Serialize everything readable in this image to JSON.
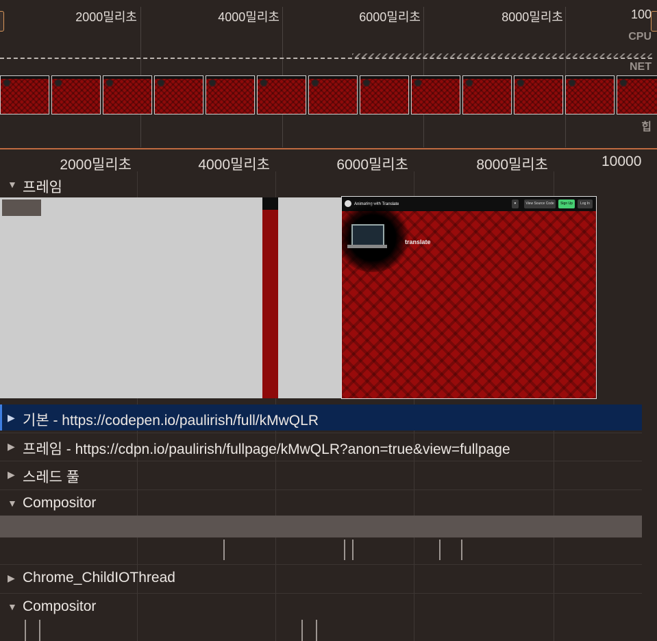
{
  "overview": {
    "ticks": [
      "2000밀리초",
      "4000밀리초",
      "6000밀리초",
      "8000밀리초",
      "100"
    ],
    "row_labels": {
      "cpu": "CPU",
      "net": "NET",
      "heap": "힙"
    },
    "filmstrip_count": 13
  },
  "ruler": {
    "ticks": [
      "2000밀리초",
      "4000밀리초",
      "6000밀리초",
      "8000밀리초",
      "10000"
    ]
  },
  "tracks": {
    "frames": {
      "title": "프레임",
      "expanded": true
    },
    "main": {
      "title": "기본 - https://codepen.io/paulirish/full/kMwQLR",
      "expanded": false,
      "selected": true
    },
    "subframe": {
      "title": "프레임 - https://cdpn.io/paulirish/fullpage/kMwQLR?anon=true&view=fullpage",
      "expanded": false
    },
    "thread_pool": {
      "title": "스레드 풀",
      "expanded": false
    },
    "compositor1": {
      "title": "Compositor",
      "expanded": true
    },
    "child_io": {
      "title": "Chrome_ChildIOThread",
      "expanded": false
    },
    "compositor2": {
      "title": "Compositor",
      "expanded": true
    }
  },
  "frame_preview": {
    "page_title": "Animating with Translate",
    "buttons": [
      "View Source Code",
      "Sign Up",
      "Log In"
    ],
    "body_text": "translate"
  },
  "icons": {
    "expanded": "▼",
    "collapsed": "▶"
  },
  "colors": {
    "background": "#2b2421",
    "selected_row": "#0b2550",
    "frame_red": "#8e0a0a",
    "overview_border": "#c06a40"
  }
}
